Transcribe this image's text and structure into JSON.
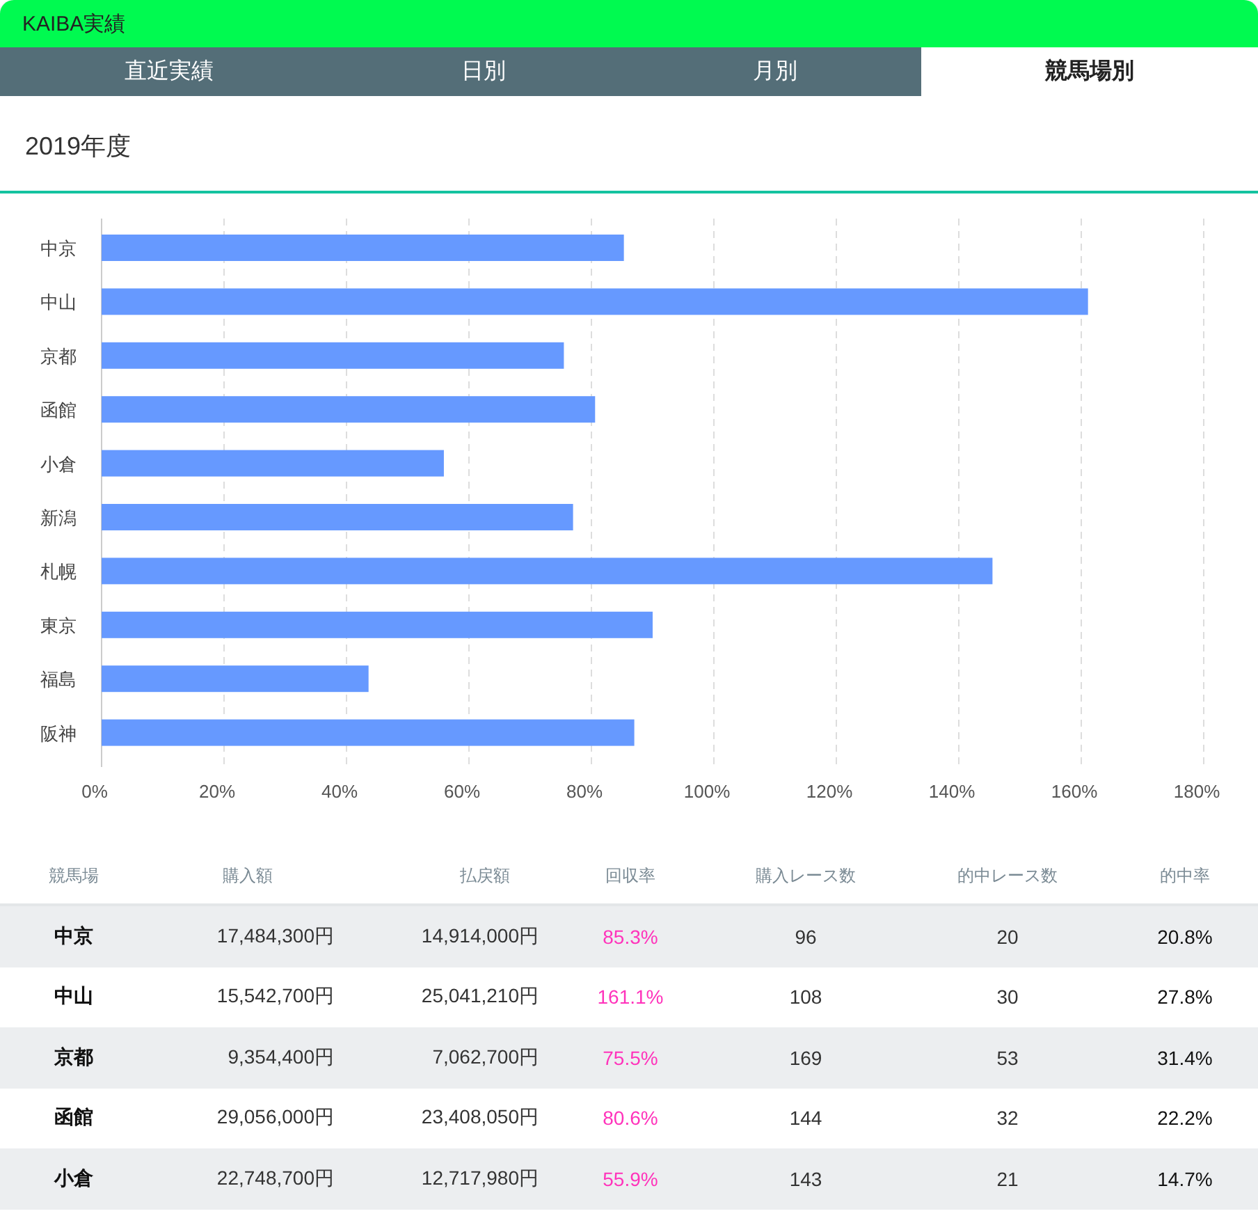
{
  "app_bar": {
    "title": "KAIBA実績"
  },
  "tabs": [
    {
      "label": "直近実績",
      "selected": false
    },
    {
      "label": "日別",
      "selected": false
    },
    {
      "label": "月別",
      "selected": false
    },
    {
      "label": "競馬場別",
      "selected": true
    }
  ],
  "period": {
    "title": "2019年度"
  },
  "chart": {
    "chart_data": {
      "type": "bar",
      "orientation": "horizontal",
      "categories": [
        "中京",
        "中山",
        "京都",
        "函館",
        "小倉",
        "新潟",
        "札幌",
        "東京",
        "福島",
        "阪神"
      ],
      "grid": true,
      "series": [
        {
          "color": "#6699ff",
          "values": [
            85.3,
            161.1,
            75.5,
            80.6,
            55.9,
            77,
            145.5,
            90,
            43.6,
            87
          ]
        }
      ],
      "xlim": [
        0,
        180
      ],
      "xticks": [
        {
          "value": 0,
          "label": "0%"
        },
        {
          "value": 20,
          "label": "20%"
        },
        {
          "value": 40,
          "label": "40%"
        },
        {
          "value": 60,
          "label": "60%"
        },
        {
          "value": 80,
          "label": "80%"
        },
        {
          "value": 100,
          "label": "100%"
        },
        {
          "value": 120,
          "label": "120%"
        },
        {
          "value": 140,
          "label": "140%"
        },
        {
          "value": 160,
          "label": "160%"
        },
        {
          "value": 180,
          "label": "180%"
        }
      ]
    }
  },
  "table": {
    "columns": [
      "競馬場",
      "購入額",
      "払戻額",
      "回収率",
      "購入レース数",
      "的中レース数",
      "的中率"
    ],
    "rows": [
      [
        "中京",
        "17,484,300円",
        "14,914,000円",
        "85.3%",
        "96",
        "20",
        "20.8%"
      ],
      [
        "中山",
        "15,542,700円",
        "25,041,210円",
        "161.1%",
        "108",
        "30",
        "27.8%"
      ],
      [
        "京都",
        "9,354,400円",
        "7,062,700円",
        "75.5%",
        "169",
        "53",
        "31.4%"
      ],
      [
        "函館",
        "29,056,000円",
        "23,408,050円",
        "80.6%",
        "144",
        "32",
        "22.2%"
      ],
      [
        "小倉",
        "22,748,700円",
        "12,717,980円",
        "55.9%",
        "143",
        "21",
        "14.7%"
      ]
    ]
  }
}
